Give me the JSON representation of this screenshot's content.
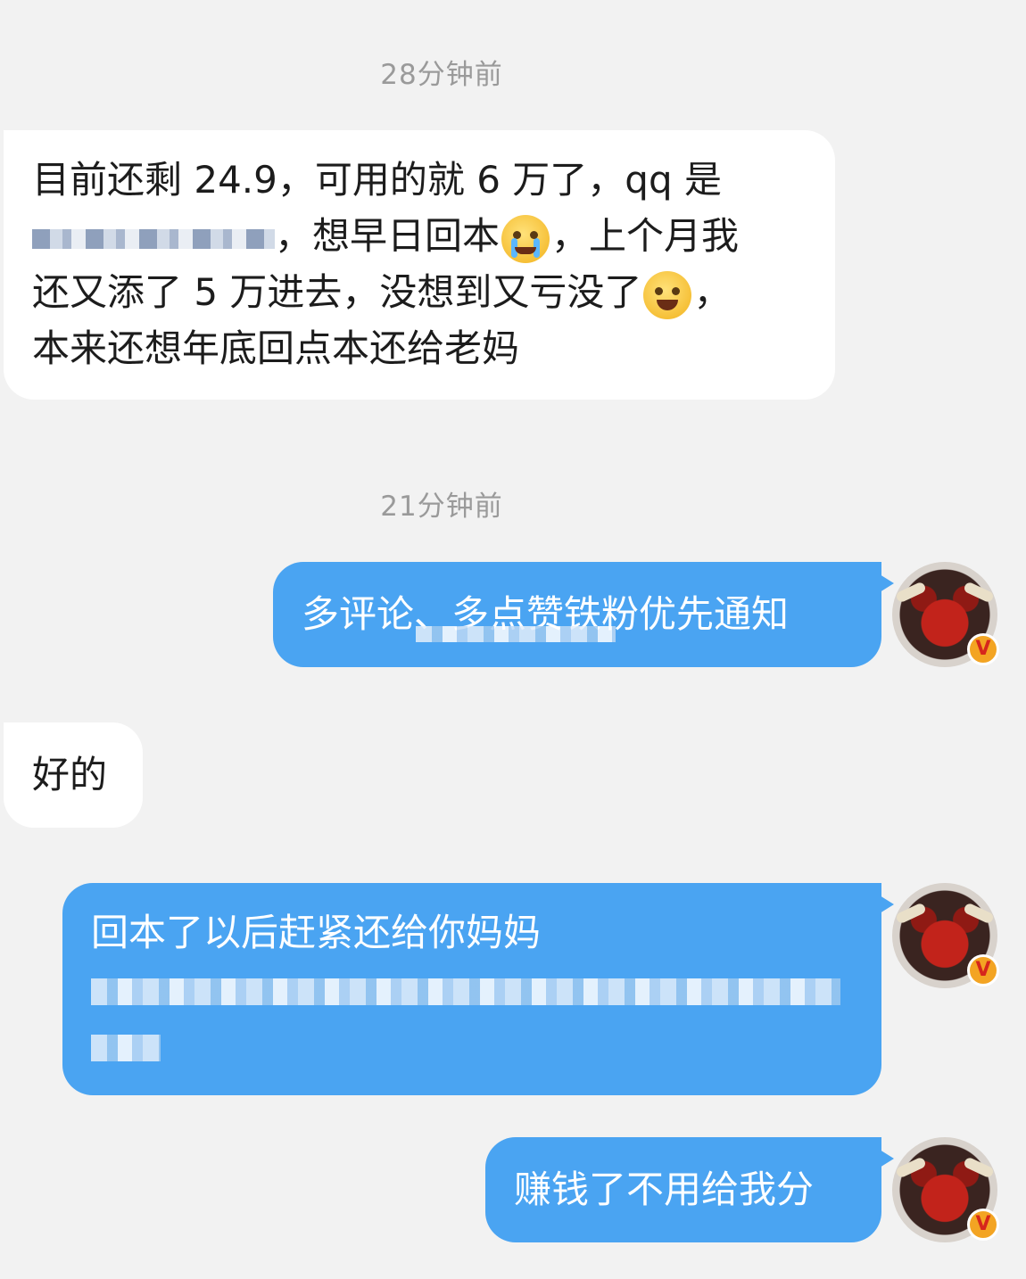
{
  "timestamps": [
    "28分钟前",
    "21分钟前"
  ],
  "messages": {
    "m1": {
      "line1": "目前还剩 24.9，可用的就 6 万了，qq 是",
      "line2_after_redact": "，想早日回本",
      "line2_end": "，上个月我",
      "line3": "还又添了 5 万进去，没想到又亏没了",
      "line3_end": "，",
      "line4": "本来还想年底回点本还给老妈"
    },
    "m2": {
      "text": "多评论、多点赞铁粉优先通知"
    },
    "m3": {
      "text": "好的"
    },
    "m4": {
      "line1": "回本了以后赶紧还给你妈妈"
    },
    "m5": {
      "text": "赚钱了不用给我分"
    }
  },
  "icons": {
    "crying": "loudly-crying-face-icon",
    "laughing": "tears-of-joy-face-icon",
    "verified": "verified-v-badge-icon"
  },
  "avatar_badge": "V",
  "colors": {
    "background": "#f2f2f2",
    "incoming_bubble": "#ffffff",
    "outgoing_bubble": "#4aa4f2",
    "timestamp": "#9a9a9a"
  }
}
